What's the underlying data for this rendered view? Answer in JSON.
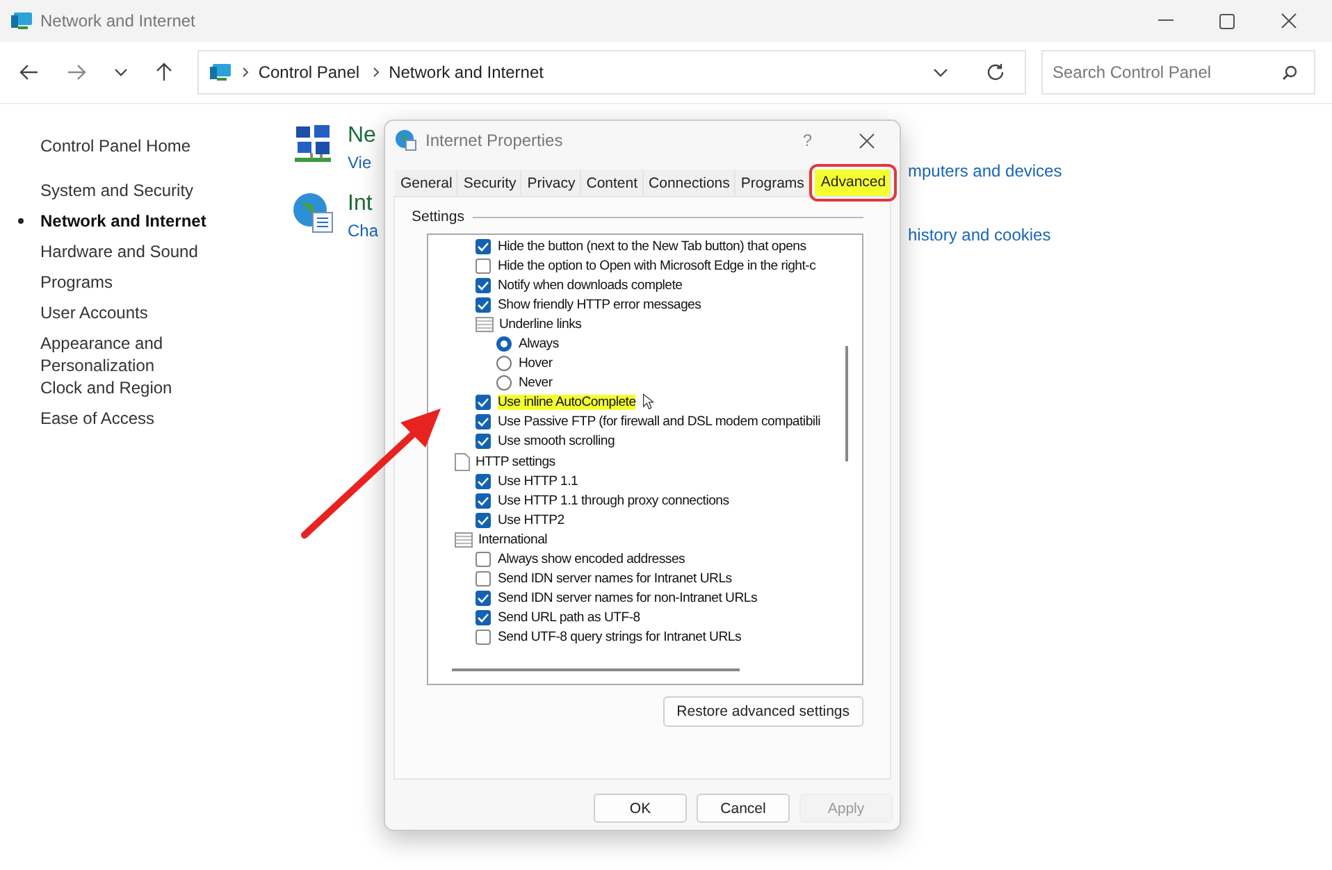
{
  "window": {
    "title": "Network and Internet"
  },
  "nav": {
    "breadcrumb": [
      "Control Panel",
      "Network and Internet"
    ],
    "search": {
      "placeholder": "Search Control Panel"
    }
  },
  "sidebar": {
    "items": [
      {
        "label": "Control Panel Home",
        "selected": false
      },
      {
        "label": "System and Security",
        "selected": false
      },
      {
        "label": "Network and Internet",
        "selected": true
      },
      {
        "label": "Hardware and Sound",
        "selected": false
      },
      {
        "label": "Programs",
        "selected": false
      },
      {
        "label": "User Accounts",
        "selected": false
      },
      {
        "label": "Appearance and Personalization",
        "selected": false
      },
      {
        "label": "Clock and Region",
        "selected": false
      },
      {
        "label": "Ease of Access",
        "selected": false
      }
    ]
  },
  "categories": [
    {
      "kind": "network",
      "title": "Ne",
      "link": "Vie",
      "link_continued": "mputers and devices"
    },
    {
      "kind": "internet",
      "title": "Int",
      "link": "Cha",
      "link_continued": "history and cookies"
    }
  ],
  "dialog": {
    "title": "Internet Properties",
    "help": "?",
    "tabs": [
      {
        "label": "General",
        "selected": false,
        "highlighted": false
      },
      {
        "label": "Security",
        "selected": false,
        "highlighted": false
      },
      {
        "label": "Privacy",
        "selected": false,
        "highlighted": false
      },
      {
        "label": "Content",
        "selected": false,
        "highlighted": false
      },
      {
        "label": "Connections",
        "selected": false,
        "highlighted": false
      },
      {
        "label": "Programs",
        "selected": false,
        "highlighted": false
      },
      {
        "label": "Advanced",
        "selected": true,
        "highlighted": true
      }
    ],
    "group_label": "Settings",
    "settings": [
      {
        "kind": "continued",
        "children": [
          {
            "kind": "checkbox",
            "label": "Hide the button (next to the New Tab button) that opens",
            "checked": true,
            "highlighted": false
          },
          {
            "kind": "checkbox",
            "label": "Hide the option to Open with Microsoft Edge in the right-c",
            "checked": false,
            "highlighted": false
          },
          {
            "kind": "checkbox",
            "label": "Notify when downloads complete",
            "checked": true,
            "highlighted": false
          },
          {
            "kind": "checkbox",
            "label": "Show friendly HTTP error messages",
            "checked": true,
            "highlighted": false
          },
          {
            "kind": "group",
            "label": "Underline links",
            "children": [
              {
                "kind": "radio",
                "label": "Always",
                "selected": true
              },
              {
                "kind": "radio",
                "label": "Hover",
                "selected": false
              },
              {
                "kind": "radio",
                "label": "Never",
                "selected": false
              }
            ]
          },
          {
            "kind": "checkbox",
            "label": "Use inline AutoComplete",
            "checked": true,
            "highlighted": true
          },
          {
            "kind": "checkbox",
            "label": "Use Passive FTP (for firewall and DSL modem compatibili",
            "checked": true,
            "highlighted": false
          },
          {
            "kind": "checkbox",
            "label": "Use smooth scrolling",
            "checked": true,
            "highlighted": false
          }
        ]
      },
      {
        "kind": "page",
        "label": "HTTP settings",
        "children": [
          {
            "kind": "checkbox",
            "label": "Use HTTP 1.1",
            "checked": true,
            "highlighted": false
          },
          {
            "kind": "checkbox",
            "label": "Use HTTP 1.1 through proxy connections",
            "checked": true,
            "highlighted": false
          },
          {
            "kind": "checkbox",
            "label": "Use HTTP2",
            "checked": true,
            "highlighted": false
          }
        ]
      },
      {
        "kind": "group",
        "label": "International",
        "children": [
          {
            "kind": "checkbox",
            "label": "Always show encoded addresses",
            "checked": false,
            "highlighted": false
          },
          {
            "kind": "checkbox",
            "label": "Send IDN server names for Intranet URLs",
            "checked": false,
            "highlighted": false
          },
          {
            "kind": "checkbox",
            "label": "Send IDN server names for non-Intranet URLs",
            "checked": true,
            "highlighted": false
          },
          {
            "kind": "checkbox",
            "label": "Send URL path as UTF-8",
            "checked": true,
            "highlighted": false
          },
          {
            "kind": "checkbox",
            "label": "Send UTF-8 query strings for Intranet URLs",
            "checked": false,
            "highlighted": false
          }
        ]
      }
    ],
    "restore_button": "Restore advanced settings",
    "buttons": [
      {
        "label": "OK",
        "disabled": false
      },
      {
        "label": "Cancel",
        "disabled": false
      },
      {
        "label": "Apply",
        "disabled": true
      }
    ]
  }
}
